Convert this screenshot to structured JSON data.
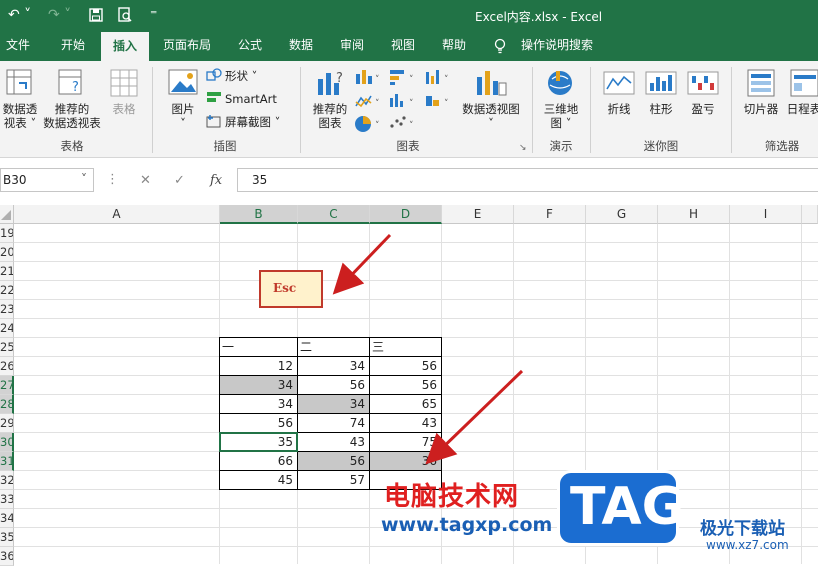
{
  "titlebar": {
    "title": "Excel内容.xlsx  -  Excel",
    "undo": "↶ ˅",
    "redo": "↷ ˅",
    "customize": "⁼"
  },
  "tabs": [
    "文件",
    "开始",
    "插入",
    "页面布局",
    "公式",
    "数据",
    "审阅",
    "视图",
    "帮助",
    "操作说明搜索"
  ],
  "active_tab": "插入",
  "ribbon": {
    "tables": {
      "pivot_l1": "数据透",
      "pivot_l2": "视表 ˅",
      "rec_pivot_l1": "推荐的",
      "rec_pivot_l2": "数据透视表",
      "table": "表格",
      "group": "表格"
    },
    "illustrations": {
      "pictures_l1": "图片",
      "pictures_l2": "˅",
      "shapes": "形状 ˅",
      "smartart": "SmartArt",
      "screenshot": "屏幕截图 ˅",
      "group": "插图"
    },
    "charts": {
      "rec_l1": "推荐的",
      "rec_l2": "图表",
      "pivotchart_l1": "数据透视图",
      "pivotchart_l2": "˅",
      "group": "图表",
      "launcher": "↘"
    },
    "tours": {
      "map_l1": "三维地",
      "map_l2": "图 ˅",
      "group": "演示"
    },
    "sparklines": {
      "line": "折线",
      "column": "柱形",
      "winloss": "盈亏",
      "group": "迷你图"
    },
    "filters": {
      "slicer": "切片器",
      "timeline": "日程表",
      "group": "筛选器"
    }
  },
  "formula_bar": {
    "name_box": "B30",
    "name_dropdown": "˅",
    "cancel": "✕",
    "enter": "✓",
    "fx": "fx",
    "value": "35"
  },
  "columns": [
    "A",
    "B",
    "C",
    "D",
    "E",
    "F",
    "G",
    "H",
    "I"
  ],
  "rows": [
    "19",
    "20",
    "21",
    "22",
    "23",
    "24",
    "25",
    "26",
    "27",
    "28",
    "29",
    "30",
    "31",
    "32",
    "33",
    "34",
    "35",
    "36"
  ],
  "selected_columns": [
    "B",
    "C",
    "D"
  ],
  "selected_rows": [
    "27",
    "28",
    "30",
    "31"
  ],
  "table": {
    "headers": [
      "一",
      "二",
      "三"
    ],
    "rows": [
      [
        "12",
        "34",
        "56"
      ],
      [
        "34",
        "56",
        "56"
      ],
      [
        "34",
        "34",
        "65"
      ],
      [
        "56",
        "74",
        "43"
      ],
      [
        "35",
        "43",
        "75"
      ],
      [
        "66",
        "56",
        "36"
      ],
      [
        "45",
        "57",
        ""
      ]
    ],
    "highlighted": [
      [
        1,
        0
      ],
      [
        2,
        1
      ],
      [
        5,
        1
      ],
      [
        5,
        2
      ]
    ],
    "active_cell": [
      4,
      0
    ]
  },
  "annotation": {
    "key_label": "Esc",
    "arrow_color": "#cc1f1f"
  },
  "watermark": {
    "cn": "电脑技术网",
    "url": "www.tagxp.com",
    "tag": "TAG",
    "site_cn": "极光下载站",
    "site_url": "www.xz7.com"
  },
  "colors": {
    "excel_green": "#217346",
    "selection_fill": "#c8c8c8",
    "esc_fill": "#fff2cc"
  }
}
